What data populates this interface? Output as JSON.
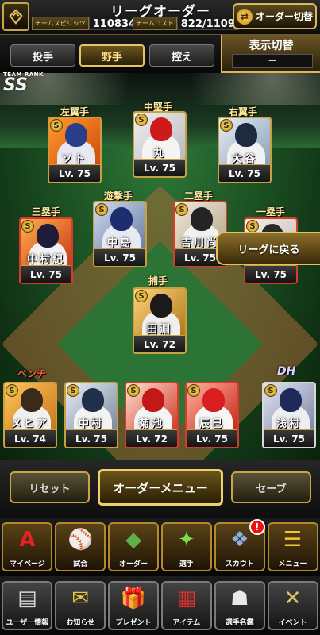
{
  "header": {
    "title": "リーグオーダー",
    "spirit_label": "チームスピリッツ",
    "spirit_value": "110834",
    "cost_label": "チームコスト",
    "cost_value": "822/1109",
    "order_switch_label": "オーダー切替"
  },
  "tabs": [
    {
      "label": "投手",
      "active": false
    },
    {
      "label": "野手",
      "active": true
    },
    {
      "label": "控え",
      "active": false
    }
  ],
  "display_switch": {
    "title": "表示切替",
    "value": "－"
  },
  "team_rank": {
    "label": "TEAM RANK",
    "value": "SS"
  },
  "positions": {
    "lf": "左翼手",
    "cf": "中堅手",
    "rf": "右翼手",
    "ss": "遊撃手",
    "second": "二塁手",
    "third": "三塁手",
    "first": "一塁手",
    "catcher": "捕手",
    "bench": "ベンチ",
    "dh": "DH"
  },
  "players": {
    "lf": {
      "name": "ソト",
      "level": "Lv. 75"
    },
    "cf": {
      "name": "丸",
      "level": "Lv. 75"
    },
    "rf": {
      "name": "大谷",
      "level": "Lv. 75"
    },
    "third": {
      "name": "中村紀",
      "level": "Lv. 75"
    },
    "ss": {
      "name": "中島",
      "level": "Lv. 75"
    },
    "second": {
      "name": "吉川尚",
      "level": "Lv. 75"
    },
    "first": {
      "name": "落合",
      "level": "Lv. 75"
    },
    "catcher": {
      "name": "田淵",
      "level": "Lv. 72"
    },
    "bench1": {
      "name": "メヒア",
      "level": "Lv. 74"
    },
    "bench2": {
      "name": "中村",
      "level": "Lv. 75"
    },
    "bench3": {
      "name": "菊池",
      "level": "Lv. 72"
    },
    "bench4": {
      "name": "辰己",
      "level": "Lv. 75"
    },
    "dh": {
      "name": "浅村",
      "level": "Lv. 75"
    }
  },
  "card_badge": "S",
  "back_button": "リーグに戻る",
  "actions": {
    "reset": "リセット",
    "menu": "オーダーメニュー",
    "save": "セーブ"
  },
  "menu_row1": [
    {
      "label": "マイページ",
      "icon": "A"
    },
    {
      "label": "試合",
      "icon": "⚾"
    },
    {
      "label": "オーダー",
      "icon": "◆"
    },
    {
      "label": "選手",
      "icon": "✦"
    },
    {
      "label": "スカウト",
      "icon": "❖",
      "badge": "!"
    },
    {
      "label": "メニュー",
      "icon": "☰"
    }
  ],
  "menu_row2": [
    {
      "label": "ユーザー情報",
      "icon": "▤"
    },
    {
      "label": "お知らせ",
      "icon": "✉"
    },
    {
      "label": "プレゼント",
      "icon": "🎁"
    },
    {
      "label": "アイテム",
      "icon": "▦"
    },
    {
      "label": "選手名鑑",
      "icon": "☗"
    },
    {
      "label": "イベント",
      "icon": "✕"
    }
  ]
}
